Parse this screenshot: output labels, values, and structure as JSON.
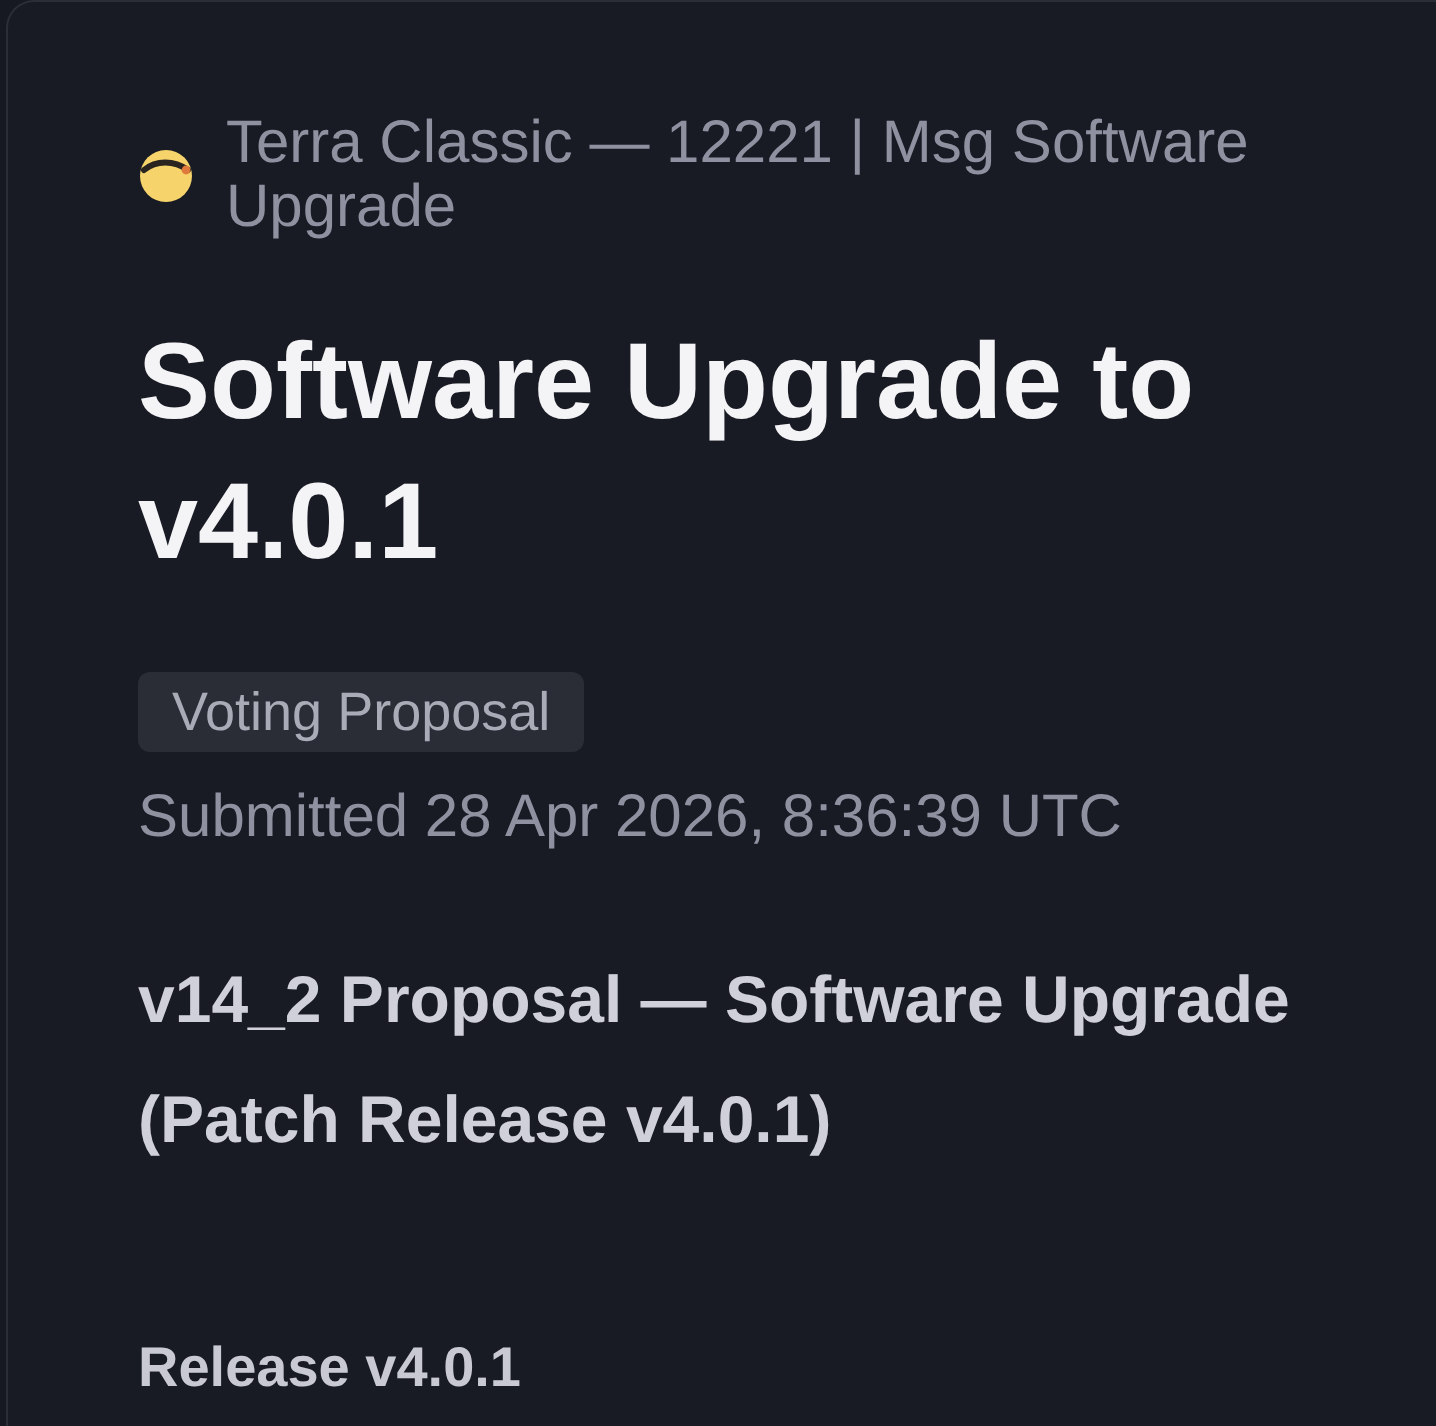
{
  "chain": {
    "label": "Terra Classic — 12221 | Msg Software Upgrade"
  },
  "title": "Software Upgrade to v4.0.1",
  "badge": "Voting Proposal",
  "submitted": "Submitted 28 Apr 2026, 8:36:39 UTC",
  "description": {
    "heading": "v14_2 Proposal — Software Upgrade (Patch Release v4.0.1)",
    "subheading": "Release v4.0.1"
  }
}
